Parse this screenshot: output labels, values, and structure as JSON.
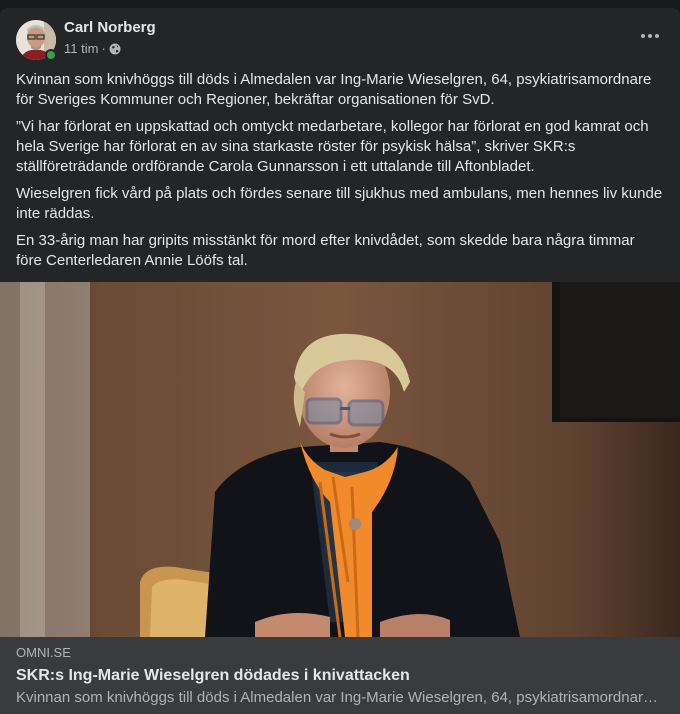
{
  "post": {
    "author": "Carl Norberg",
    "time": "11 tim",
    "separator": "·",
    "paragraphs": [
      "Kvinnan som knivhöggs till döds i Almedalen var Ing-Marie Wieselgren, 64, psykiatrisamordnare för Sveriges Kommuner och Regioner, bekräftar organisationen för SvD.",
      "”Vi har förlorat en uppskattad och omtyckt medarbetare, kollegor har förlorat en god kamrat och hela Sverige har förlorat en av sina starkaste röster för psykisk hälsa”, skriver SKR:s ställföreträdande ordförande Carola Gunnarsson i ett uttalande till Aftonbladet.",
      "Wieselgren fick vård på plats och fördes senare till sjukhus med ambulans, men hennes liv kunde inte räddas.",
      "En 33-årig man har gripits misstänkt för mord efter knivdådet, som skedde bara några timmar före Centerledaren Annie Lööfs tal."
    ]
  },
  "link": {
    "domain": "OMNI.SE",
    "title": "SKR:s Ing-Marie Wieselgren dödades i knivattacken",
    "description": "Kvinnan som knivhöggs till döds i Almedalen var Ing-Marie Wieselgren, 64, psykiatrisamordnare för Sveriges Kommuner och Regioner, bekräftar organisationen för SvD."
  },
  "icons": {
    "privacy": "globe-icon",
    "more": "more-horizontal-icon",
    "presence": "online-status-dot"
  },
  "colors": {
    "card_background": "#242526",
    "link_background": "#3a3b3c",
    "primary_text": "#e4e6eb",
    "secondary_text": "#b0b3b8",
    "online": "#31a24c",
    "scarf": "#f08a2a"
  }
}
